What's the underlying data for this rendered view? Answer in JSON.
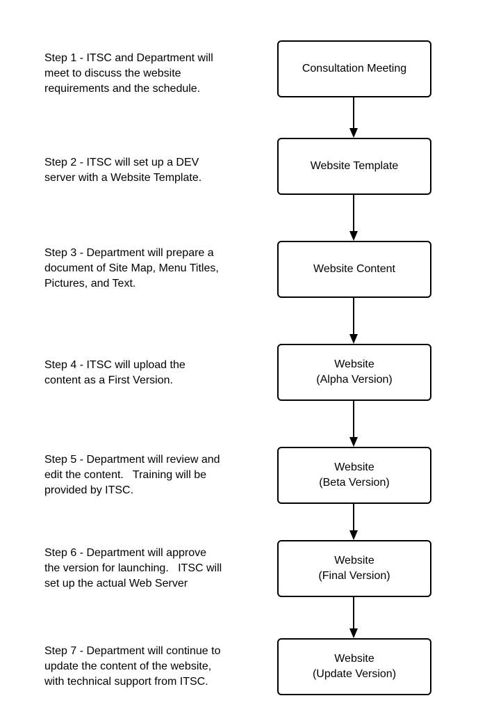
{
  "steps": [
    {
      "lines": [
        "Step 1 - ITSC and Department will",
        "meet to discuss the website",
        "requirements and the schedule."
      ]
    },
    {
      "lines": [
        "Step 2 - ITSC will set up a DEV",
        "server with a Website Template."
      ]
    },
    {
      "lines": [
        "Step 3 - Department will prepare a",
        "document of Site Map, Menu Titles,",
        "Pictures, and Text."
      ]
    },
    {
      "lines": [
        "Step 4 - ITSC will upload the",
        "content as a First Version."
      ]
    },
    {
      "lines": [
        "Step 5 - Department will review and",
        "edit the content.   Training will be",
        "provided by ITSC."
      ]
    },
    {
      "lines": [
        "Step 6 - Department will approve",
        "the version for launching.   ITSC will",
        "set up the actual Web Server"
      ]
    },
    {
      "lines": [
        "Step 7 - Department will continue to",
        "update the content of the website,",
        "with technical support from ITSC."
      ]
    }
  ],
  "boxes": [
    {
      "lines": [
        "Consultation Meeting"
      ]
    },
    {
      "lines": [
        "Website Template"
      ]
    },
    {
      "lines": [
        "Website Content"
      ]
    },
    {
      "lines": [
        "Website",
        "(Alpha Version)"
      ]
    },
    {
      "lines": [
        "Website",
        "(Beta Version)"
      ]
    },
    {
      "lines": [
        "Website",
        "(Final Version)"
      ]
    },
    {
      "lines": [
        "Website",
        "(Update Version)"
      ]
    }
  ],
  "colors": {
    "stroke": "#000000",
    "background": "#ffffff"
  }
}
